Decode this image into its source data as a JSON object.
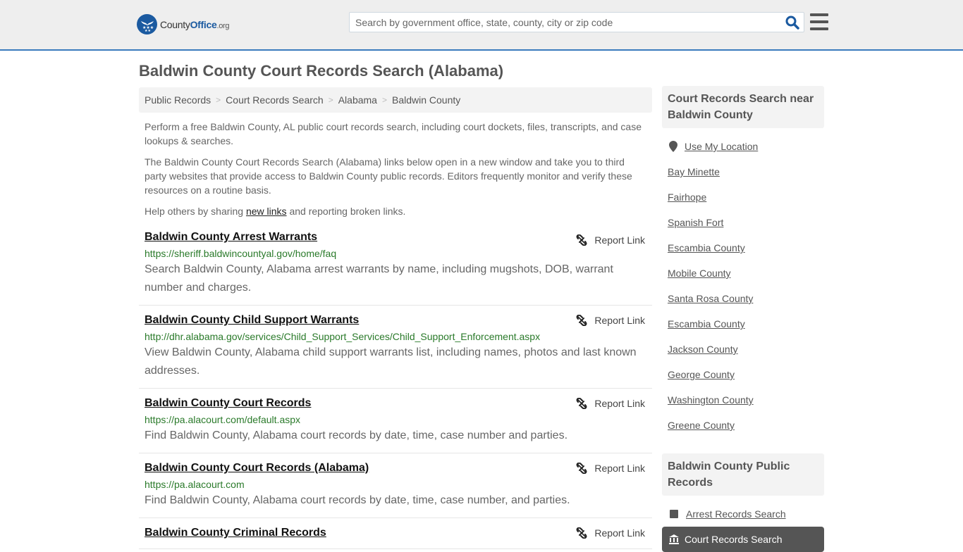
{
  "header": {
    "logo": {
      "name": "County",
      "name_accent": "Office",
      "tld": ".org"
    },
    "search": {
      "placeholder": "Search by government office, state, county, city or zip code",
      "value": ""
    },
    "icons": {
      "search": "search-icon",
      "menu": "hamburger-menu-icon"
    }
  },
  "page": {
    "title": "Baldwin County Court Records Search (Alabama)",
    "breadcrumb": [
      "Public Records",
      "Court Records Search",
      "Alabama",
      "Baldwin County"
    ],
    "intro": {
      "p1": "Perform a free Baldwin County, AL public court records search, including court dockets, files, transcripts, and case lookups & searches.",
      "p2": "The Baldwin County Court Records Search (Alabama) links below open in a new window and take you to third party websites that provide access to Baldwin County public records. Editors frequently monitor and verify these resources on a routine basis.",
      "p3_before": "Help others by sharing ",
      "p3_link": "new links",
      "p3_after": " and reporting broken links."
    },
    "report_label": "Report Link",
    "results": [
      {
        "title": "Baldwin County Arrest Warrants",
        "url": "https://sheriff.baldwincountyal.gov/home/faq",
        "description": "Search Baldwin County, Alabama arrest warrants by name, including mugshots, DOB, warrant number and charges."
      },
      {
        "title": "Baldwin County Child Support Warrants",
        "url": "http://dhr.alabama.gov/services/Child_Support_Services/Child_Support_Enforcement.aspx",
        "description": "View Baldwin County, Alabama child support warrants list, including names, photos and last known addresses."
      },
      {
        "title": "Baldwin County Court Records",
        "url": "https://pa.alacourt.com/default.aspx",
        "description": "Find Baldwin County, Alabama court records by date, time, case number and parties."
      },
      {
        "title": "Baldwin County Court Records (Alabama)",
        "url": "https://pa.alacourt.com",
        "description": "Find Baldwin County, Alabama court records by date, time, case number, and parties."
      },
      {
        "title": "Baldwin County Criminal Records",
        "url": "",
        "description": ""
      }
    ]
  },
  "sidebar": {
    "nearby_heading": "Court Records Search near Baldwin County",
    "use_location": "Use My Location",
    "nearby": [
      "Bay Minette",
      "Fairhope",
      "Spanish Fort",
      "Escambia County",
      "Mobile County",
      "Santa Rosa County",
      "Escambia County",
      "Jackson County",
      "George County",
      "Washington County",
      "Greene County"
    ],
    "public_records_heading": "Baldwin County Public Records",
    "public_records": [
      "Arrest Records Search"
    ],
    "active_item": "Court Records Search"
  }
}
